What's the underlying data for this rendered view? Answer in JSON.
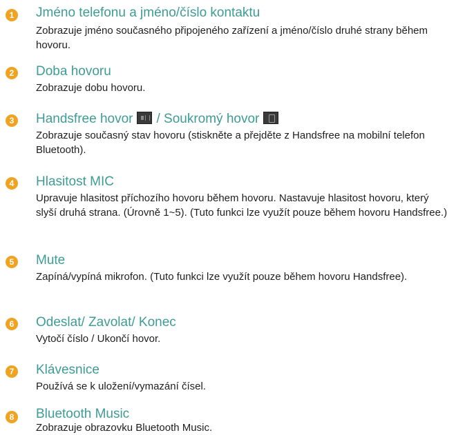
{
  "items": [
    {
      "number": "1",
      "title": "Jméno telefonu a jméno/číslo kontaktu",
      "description": "Zobrazuje jméno současného připojeného zařízení a jméno/číslo druhé strany během hovoru."
    },
    {
      "number": "2",
      "title": "Doba hovoru",
      "description": "Zobrazuje dobu hovoru."
    },
    {
      "number": "3",
      "title_part1": "Handsfree hovor",
      "title_part2": "/ Soukromý hovor",
      "icon_handsfree": "handsfree-call-icon",
      "icon_private": "private-call-icon",
      "description": "Zobrazuje současný stav hovoru (stiskněte a přejděte z Handsfree na mobilní telefon Bluetooth)."
    },
    {
      "number": "4",
      "title": "Hlasitost MIC",
      "description": "Upravuje hlasitost příchozího hovoru během hovoru. Nastavuje hlasitost hovoru, který slyší druhá strana. (Úrovně 1~5). (Tuto funkci lze využít pouze během hovoru Handsfree.)"
    },
    {
      "number": "5",
      "title": "Mute",
      "description": "Zapíná/vypíná mikrofon. (Tuto funkci lze využít pouze během hovoru Handsfree)."
    },
    {
      "number": "6",
      "title": "Odeslat/ Zavolat/ Konec",
      "description": "Vytočí číslo / Ukončí hovor."
    },
    {
      "number": "7",
      "title": "Klávesnice",
      "description": "Používá se k uložení/vymazání čísel."
    },
    {
      "number": "8",
      "title": "Bluetooth Music",
      "description": "Zobrazuje obrazovku Bluetooth Music."
    }
  ],
  "colors": {
    "badge": "#f0a321",
    "title": "#3e9b95",
    "text": "#1e1e1e"
  }
}
